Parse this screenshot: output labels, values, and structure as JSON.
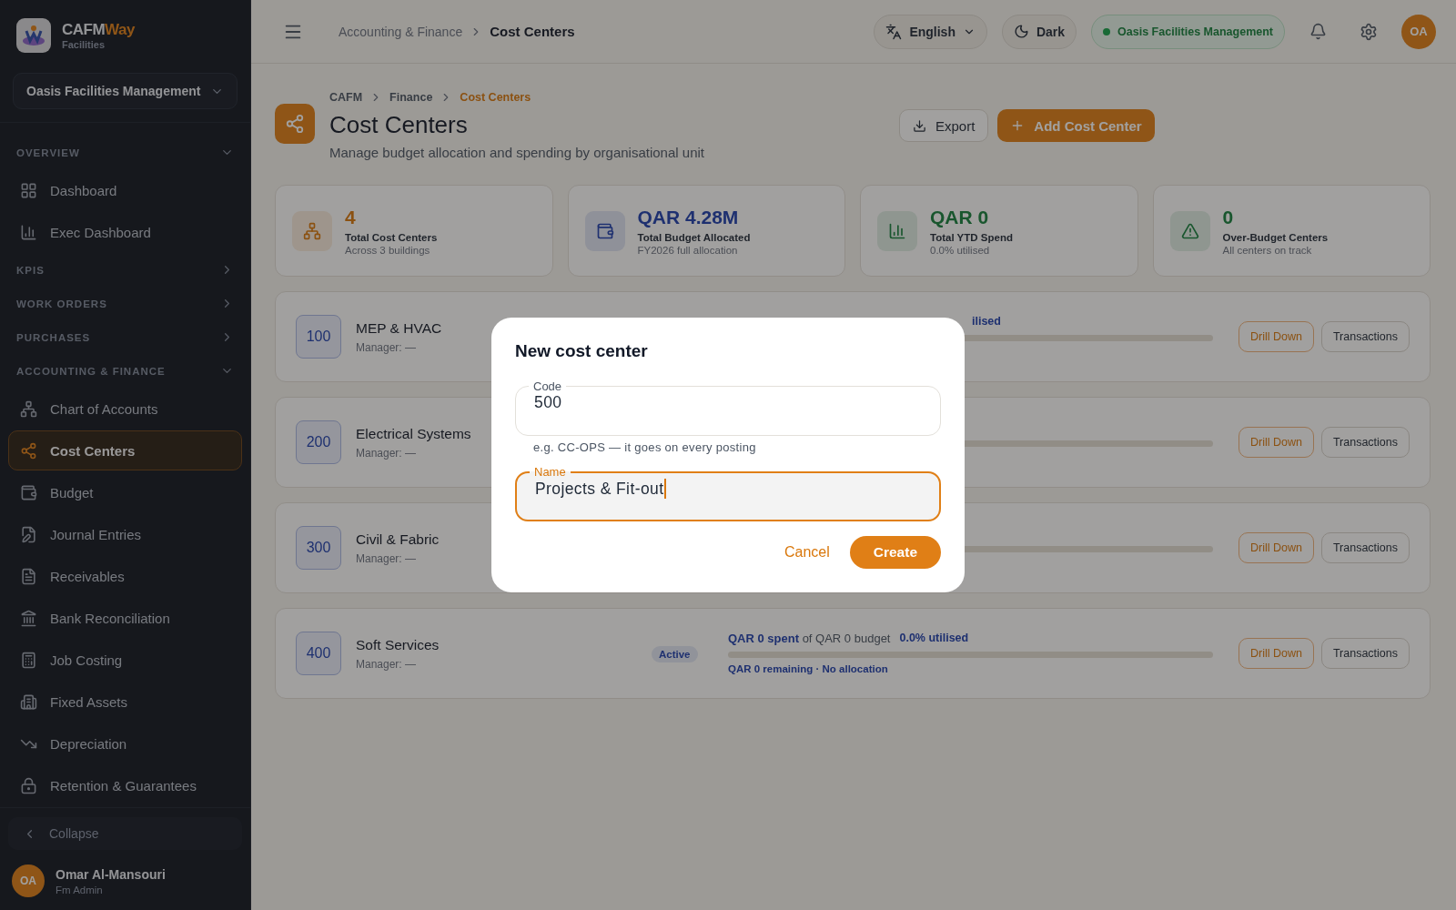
{
  "brand": {
    "name_a": "CAFM",
    "name_b": "Way",
    "sub": "Facilities"
  },
  "org_select": {
    "value": "Oasis Facilities Management"
  },
  "nav": [
    {
      "kind": "section",
      "label": "OVERVIEW",
      "expanded": true
    },
    {
      "kind": "item",
      "label": "Dashboard",
      "selected": false
    },
    {
      "kind": "item",
      "label": "Exec Dashboard",
      "selected": false
    },
    {
      "kind": "section",
      "label": "KPIS",
      "expanded": false
    },
    {
      "kind": "section",
      "label": "WORK ORDERS",
      "expanded": false
    },
    {
      "kind": "section",
      "label": "PURCHASES",
      "expanded": false
    },
    {
      "kind": "section",
      "label": "ACCOUNTING & FINANCE",
      "expanded": true
    },
    {
      "kind": "item",
      "label": "Chart of Accounts",
      "selected": false
    },
    {
      "kind": "item",
      "label": "Cost Centers",
      "selected": true
    },
    {
      "kind": "item",
      "label": "Budget",
      "selected": false
    },
    {
      "kind": "item",
      "label": "Journal Entries",
      "selected": false
    },
    {
      "kind": "item",
      "label": "Receivables",
      "selected": false
    },
    {
      "kind": "item",
      "label": "Bank Reconciliation",
      "selected": false
    },
    {
      "kind": "item",
      "label": "Job Costing",
      "selected": false
    },
    {
      "kind": "item",
      "label": "Fixed Assets",
      "selected": false
    },
    {
      "kind": "item",
      "label": "Depreciation",
      "selected": false
    },
    {
      "kind": "item",
      "label": "Retention & Guarantees",
      "selected": false
    }
  ],
  "collapse": {
    "label": "Collapse"
  },
  "user": {
    "initials": "OA",
    "name": "Omar Al-Mansouri",
    "role": "Fm Admin"
  },
  "header": {
    "breadcrumb": [
      "Accounting & Finance",
      "Cost Centers"
    ],
    "language": "English",
    "theme": "Dark",
    "org": "Oasis Facilities Management",
    "avatar": "OA"
  },
  "page": {
    "breadcrumb": [
      "CAFM",
      "Finance",
      "Cost Centers"
    ],
    "title": "Cost Centers",
    "subtitle": "Manage budget allocation and spending by organisational unit",
    "export": "Export",
    "add": "Add Cost Center"
  },
  "stats": [
    {
      "value": "4",
      "label": "Total Cost Centers",
      "sub": "Across 3 buildings"
    },
    {
      "value": "QAR 4.28M",
      "label": "Total Budget Allocated",
      "sub": "FY2026 full allocation"
    },
    {
      "value": "QAR 0",
      "label": "Total YTD Spend",
      "sub": "0.0% utilised"
    },
    {
      "value": "0",
      "label": "Over-Budget Centers",
      "sub": "All centers on track"
    }
  ],
  "centers": [
    {
      "code": "100",
      "name": "MEP & HVAC",
      "manager": "Manager: —",
      "summary_fragment": "ilised",
      "level": 0,
      "drill": "Drill Down",
      "tx": "Transactions"
    },
    {
      "code": "200",
      "name": "Electrical Systems",
      "manager": "Manager: —",
      "level": 0,
      "drill": "Drill Down",
      "tx": "Transactions"
    },
    {
      "code": "300",
      "name": "Civil & Fabric",
      "manager": "Manager: —",
      "level": 0,
      "drill": "Drill Down",
      "tx": "Transactions"
    },
    {
      "code": "400",
      "name": "Soft Services",
      "manager": "Manager: —",
      "status": "Active",
      "summary": "**QAR 0 spent** of QAR 0 budget",
      "utilised": "0.0% utilised",
      "level": 0,
      "footnote": "QAR 0 remaining · No allocation",
      "drill": "Drill Down",
      "tx": "Transactions"
    }
  ],
  "dialog": {
    "title": "New cost center",
    "fields": [
      {
        "label": "Code",
        "value": "500",
        "helper": "e.g. CC-OPS — it goes on every posting",
        "focused": false
      },
      {
        "label": "Name",
        "value": "Projects & Fit-out",
        "focused": true
      }
    ],
    "cancel": "Cancel",
    "create": "Create"
  }
}
